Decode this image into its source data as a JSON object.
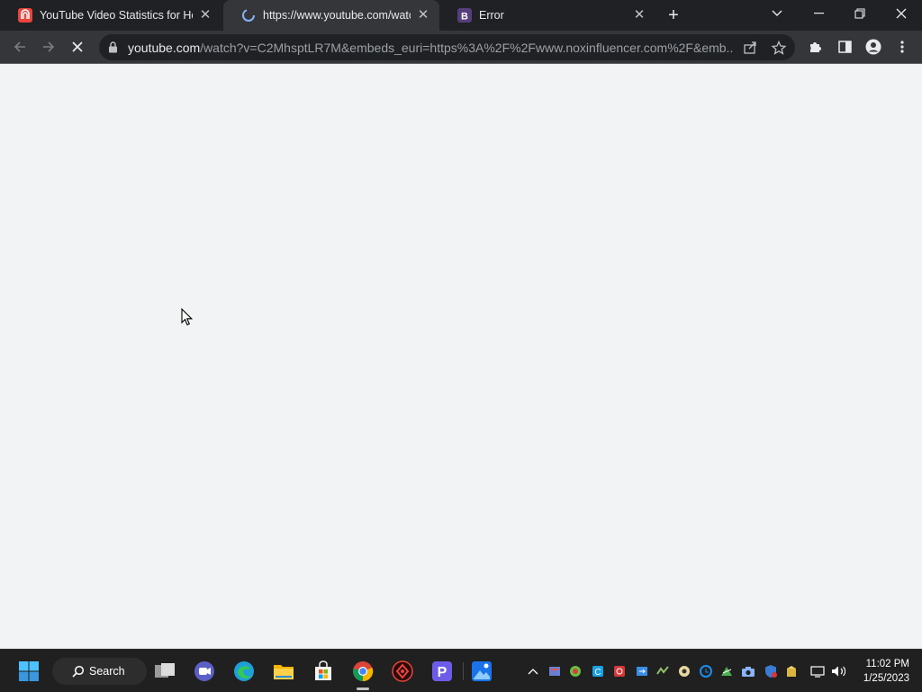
{
  "browser": {
    "tabs": [
      {
        "title": "YouTube Video Statistics for How",
        "favicon": "noxinfluencer-icon",
        "active": false
      },
      {
        "title": "https://www.youtube.com/watch",
        "favicon": "loading-spinner-icon",
        "active": true
      },
      {
        "title": "Error",
        "favicon": "bootstrap-b-icon",
        "active": false
      }
    ],
    "new_tab": "+",
    "window_controls": [
      "tab-search-icon",
      "minimize-icon",
      "restore-icon",
      "close-icon"
    ],
    "toolbar": {
      "url_host": "youtube.com",
      "url_path": "/watch?v=C2MhsptLR7M&embeds_euri=https%3A%2F%2Fwww.noxinfluencer.com%2F&emb...",
      "icons": [
        "back-arrow-icon",
        "forward-arrow-icon",
        "stop-loading-icon",
        "lock-icon",
        "share-icon",
        "bookmark-star-icon",
        "extensions-puzzle-icon",
        "side-panel-icon",
        "profile-icon",
        "menu-dots-icon"
      ]
    }
  },
  "taskbar": {
    "search_label": "Search",
    "pinned": [
      "windows-start-icon",
      "task-view-icon",
      "teams-chat-icon",
      "edge-icon",
      "file-explorer-icon",
      "microsoft-store-icon",
      "chrome-icon",
      "app-red-icon",
      "p-app-icon",
      "photos-icon"
    ],
    "tray": [
      "chevron-up-icon"
    ],
    "time": "11:02 PM",
    "date": "1/25/2023"
  },
  "colors": {
    "tabstrip": "#202124",
    "toolbar": "#35363a",
    "page": "#f1f3f4",
    "taskbar": "#202020",
    "accent_red": "#e8453c",
    "windows_blue": "#3a96dd"
  }
}
